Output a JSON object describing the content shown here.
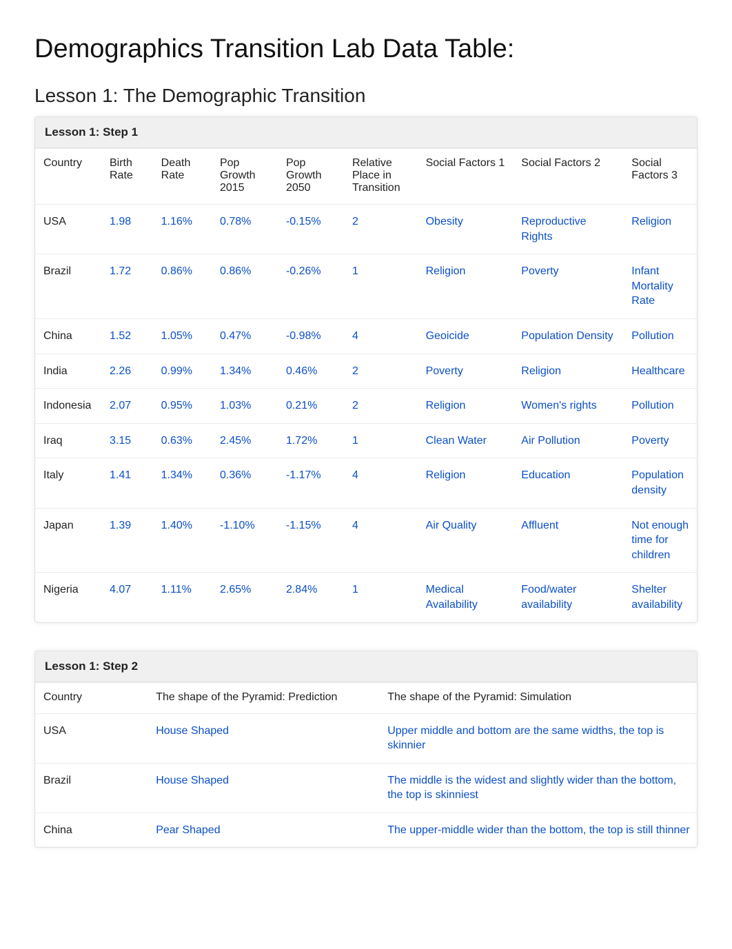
{
  "title": "Demographics Transition Lab Data Table:",
  "subtitle": "Lesson 1: The Demographic Transition",
  "step1": {
    "caption": "Lesson 1: Step 1",
    "headers": [
      "Country",
      "Birth Rate",
      "Death Rate",
      "Pop Growth 2015",
      "Pop Growth 2050",
      "Relative Place in Transition",
      "Social Factors 1",
      "Social Factors 2",
      "Social Factors 3"
    ],
    "rows": [
      {
        "country": "USA",
        "birth": "1.98",
        "death": "1.16%",
        "g2015": "0.78%",
        "g2050": "-0.15%",
        "place": "2",
        "sf1": "Obesity",
        "sf2": "Reproductive Rights",
        "sf3": "Religion"
      },
      {
        "country": "Brazil",
        "birth": "1.72",
        "death": "0.86%",
        "g2015": "0.86%",
        "g2050": "-0.26%",
        "place": "1",
        "sf1": "Religion",
        "sf2": "Poverty",
        "sf3": "Infant Mortality Rate"
      },
      {
        "country": "China",
        "birth": "1.52",
        "death": "1.05%",
        "g2015": "0.47%",
        "g2050": "-0.98%",
        "place": "4",
        "sf1": "Geoicide",
        "sf2": "Population Density",
        "sf3": "Pollution"
      },
      {
        "country": "India",
        "birth": "2.26",
        "death": "0.99%",
        "g2015": "1.34%",
        "g2050": "0.46%",
        "place": "2",
        "sf1": "Poverty",
        "sf2": "Religion",
        "sf3": "Healthcare"
      },
      {
        "country": "Indonesia",
        "birth": "2.07",
        "death": "0.95%",
        "g2015": "1.03%",
        "g2050": "0.21%",
        "place": "2",
        "sf1": "Religion",
        "sf2": "Women's rights",
        "sf3": "Pollution"
      },
      {
        "country": "Iraq",
        "birth": "3.15",
        "death": "0.63%",
        "g2015": "2.45%",
        "g2050": "1.72%",
        "place": "1",
        "sf1": "Clean Water",
        "sf2": "Air Pollution",
        "sf3": "Poverty"
      },
      {
        "country": "Italy",
        "birth": "1.41",
        "death": "1.34%",
        "g2015": "0.36%",
        "g2050": "-1.17%",
        "place": "4",
        "sf1": "Religion",
        "sf2": "Education",
        "sf3": "Population density"
      },
      {
        "country": "Japan",
        "birth": "1.39",
        "death": "1.40%",
        "g2015": "-1.10%",
        "g2050": "-1.15%",
        "place": "4",
        "sf1": "Air Quality",
        "sf2": "Affluent",
        "sf3": "Not enough time for children"
      },
      {
        "country": "Nigeria",
        "birth": "4.07",
        "death": "1.11%",
        "g2015": "2.65%",
        "g2050": "2.84%",
        "place": "1",
        "sf1": "Medical Availability",
        "sf2": "Food/water availability",
        "sf3": "Shelter availability"
      }
    ]
  },
  "step2": {
    "caption": "Lesson 1: Step 2",
    "headers": [
      "Country",
      "The shape of the Pyramid: Prediction",
      "The shape of the Pyramid: Simulation"
    ],
    "rows": [
      {
        "country": "USA",
        "pred": "House Shaped",
        "sim": "Upper middle and bottom are the same widths, the top is skinnier"
      },
      {
        "country": "Brazil",
        "pred": "House Shaped",
        "sim": "The middle is the widest and slightly wider than the bottom, the top is skinniest"
      },
      {
        "country": "China",
        "pred": "Pear Shaped",
        "sim": "The upper-middle wider than the bottom, the top is still thinner"
      }
    ]
  },
  "chart_data": {
    "type": "table",
    "tables": [
      {
        "name": "Lesson 1: Step 1",
        "columns": [
          "Country",
          "Birth Rate",
          "Death Rate",
          "Pop Growth 2015",
          "Pop Growth 2050",
          "Relative Place in Transition",
          "Social Factors 1",
          "Social Factors 2",
          "Social Factors 3"
        ],
        "rows": [
          [
            "USA",
            1.98,
            "1.16%",
            "0.78%",
            "-0.15%",
            2,
            "Obesity",
            "Reproductive Rights",
            "Religion"
          ],
          [
            "Brazil",
            1.72,
            "0.86%",
            "0.86%",
            "-0.26%",
            1,
            "Religion",
            "Poverty",
            "Infant Mortality Rate"
          ],
          [
            "China",
            1.52,
            "1.05%",
            "0.47%",
            "-0.98%",
            4,
            "Geoicide",
            "Population Density",
            "Pollution"
          ],
          [
            "India",
            2.26,
            "0.99%",
            "1.34%",
            "0.46%",
            2,
            "Poverty",
            "Religion",
            "Healthcare"
          ],
          [
            "Indonesia",
            2.07,
            "0.95%",
            "1.03%",
            "0.21%",
            2,
            "Religion",
            "Women's rights",
            "Pollution"
          ],
          [
            "Iraq",
            3.15,
            "0.63%",
            "2.45%",
            "1.72%",
            1,
            "Clean Water",
            "Air Pollution",
            "Poverty"
          ],
          [
            "Italy",
            1.41,
            "1.34%",
            "0.36%",
            "-1.17%",
            4,
            "Religion",
            "Education",
            "Population density"
          ],
          [
            "Japan",
            1.39,
            "1.40%",
            "-1.10%",
            "-1.15%",
            4,
            "Air Quality",
            "Affluent",
            "Not enough time for children"
          ],
          [
            "Nigeria",
            4.07,
            "1.11%",
            "2.65%",
            "2.84%",
            1,
            "Medical Availability",
            "Food/water availability",
            "Shelter availability"
          ]
        ]
      },
      {
        "name": "Lesson 1: Step 2",
        "columns": [
          "Country",
          "The shape of the Pyramid: Prediction",
          "The shape of the Pyramid: Simulation"
        ],
        "rows": [
          [
            "USA",
            "House Shaped",
            "Upper middle and bottom are the same widths, the top is skinnier"
          ],
          [
            "Brazil",
            "House Shaped",
            "The middle is the widest and slightly wider than the bottom, the top is skinniest"
          ],
          [
            "China",
            "Pear Shaped",
            "The upper-middle wider than the bottom, the top is still thinner"
          ]
        ]
      }
    ]
  }
}
